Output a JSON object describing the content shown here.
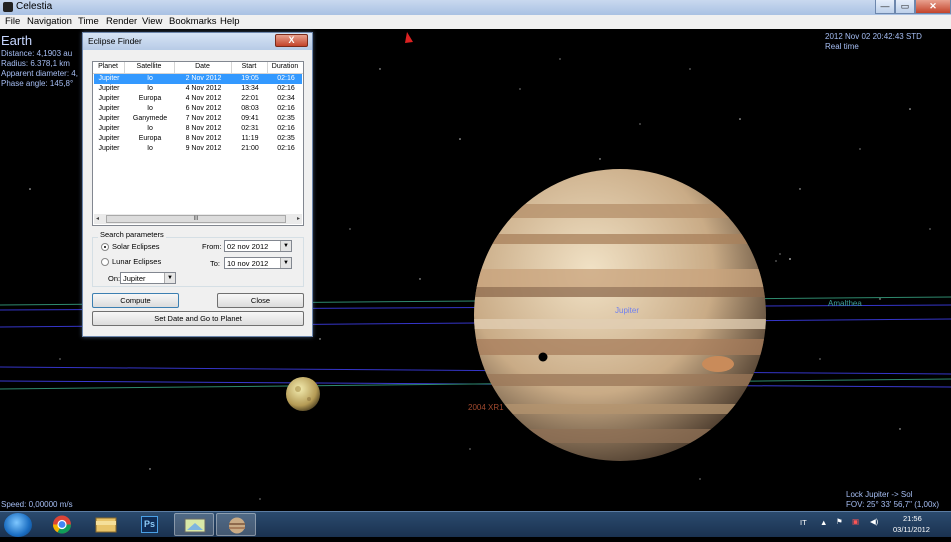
{
  "window": {
    "title": "Celestia"
  },
  "menu": [
    "File",
    "Navigation",
    "Time",
    "Render",
    "View",
    "Bookmarks",
    "Help"
  ],
  "hud": {
    "object_name": "Earth",
    "distance": "Distance: 4,1903 au",
    "radius": "Radius: 6.378,1 km",
    "apparent_diameter": "Apparent diameter: 4,",
    "phase_angle": "Phase angle: 145,8°",
    "datetime": "2012 Nov 02 20:42:43 STD",
    "time_mode": "Real time",
    "speed": "Speed: 0,00000 m/s",
    "lock": "Lock Jupiter -> Sol",
    "fov": "FOV: 25° 33' 56,7\" (1,00x)"
  },
  "scene_labels": {
    "jupiter": "Jupiter",
    "amalthea": "Amalthea",
    "xr": "2004 XR1"
  },
  "dialog": {
    "title": "Eclipse Finder",
    "close_symbol": "X",
    "columns": [
      "Planet",
      "Satellite",
      "Date",
      "Start",
      "Duration"
    ],
    "rows": [
      [
        "Jupiter",
        "Io",
        "2 Nov 2012",
        "19:05",
        "02:16"
      ],
      [
        "Jupiter",
        "Io",
        "4 Nov 2012",
        "13:34",
        "02:16"
      ],
      [
        "Jupiter",
        "Europa",
        "4 Nov 2012",
        "22:01",
        "02:34"
      ],
      [
        "Jupiter",
        "Io",
        "6 Nov 2012",
        "08:03",
        "02:16"
      ],
      [
        "Jupiter",
        "Ganymede",
        "7 Nov 2012",
        "09:41",
        "02:35"
      ],
      [
        "Jupiter",
        "Io",
        "8 Nov 2012",
        "02:31",
        "02:16"
      ],
      [
        "Jupiter",
        "Europa",
        "8 Nov 2012",
        "11:19",
        "02:35"
      ],
      [
        "Jupiter",
        "Io",
        "9 Nov 2012",
        "21:00",
        "02:16"
      ]
    ],
    "selected_row": 0,
    "scroll_thumb": "III",
    "search_params_label": "Search parameters",
    "solar_label": "Solar Eclipses",
    "lunar_label": "Lunar Eclipses",
    "selected_mode": "solar",
    "on_label": "On:",
    "on_value": "Jupiter",
    "from_label": "From:",
    "from_value": "02 nov 2012",
    "to_label": "To:",
    "to_value": "10 nov 2012",
    "compute_label": "Compute",
    "close_label": "Close",
    "setdate_label": "Set Date and Go to Planet"
  },
  "taskbar": {
    "apps": [
      "start",
      "chrome",
      "explorer",
      "photoshop",
      "windows-explorer",
      "celestia"
    ],
    "ps_label": "Ps",
    "language": "IT",
    "time": "21:56",
    "date": "03/11/2012"
  },
  "colors": {
    "hud_text": "#a7bff5",
    "orbit_lines": "#3a3ad0",
    "orbit_green": "#2f8a6e",
    "selection": "#3399ff"
  }
}
